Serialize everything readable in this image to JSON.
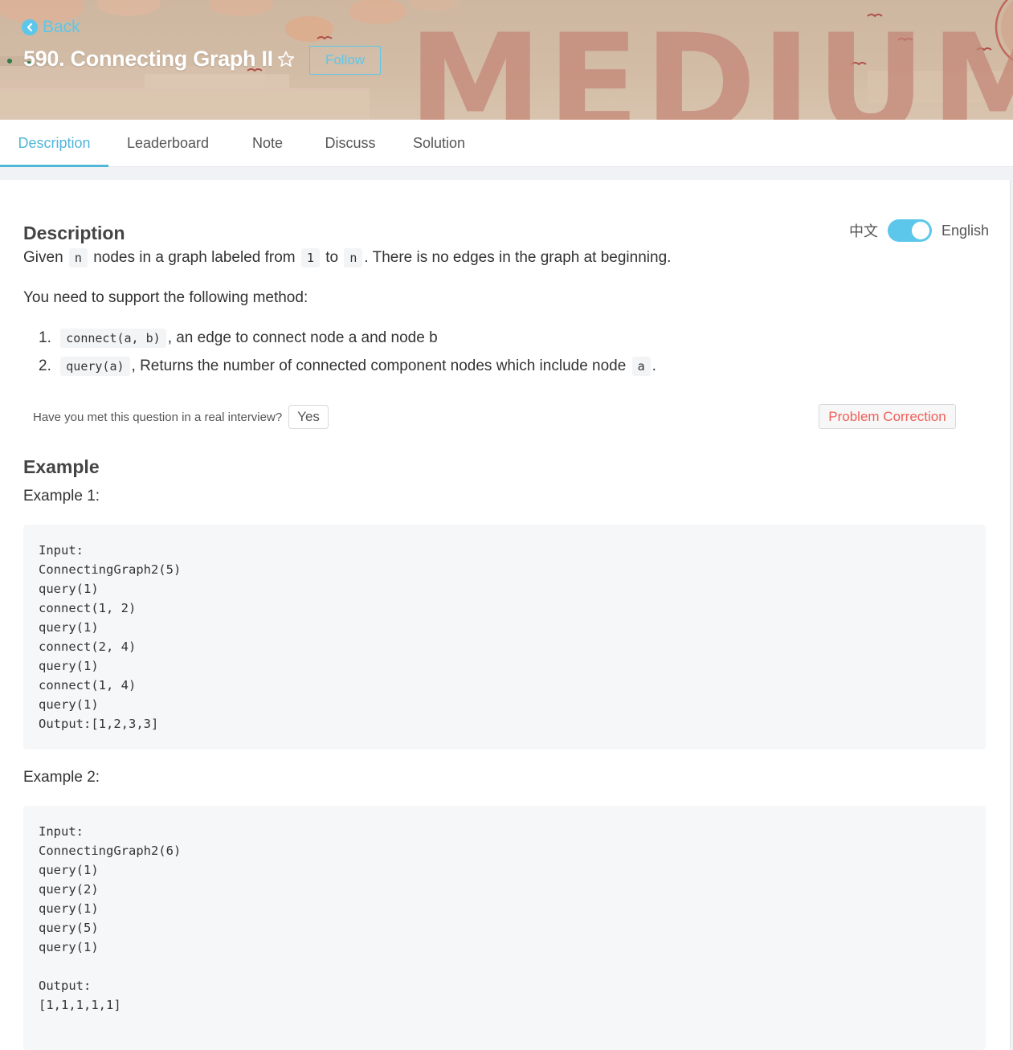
{
  "banner": {
    "back_label": "Back",
    "title": "590. Connecting Graph II",
    "follow_label": "Follow",
    "difficulty_watermark": "MEDIUM"
  },
  "tabs": [
    {
      "label": "Description",
      "active": true
    },
    {
      "label": "Leaderboard",
      "active": false
    },
    {
      "label": "Note",
      "active": false
    },
    {
      "label": "Discuss",
      "active": false
    },
    {
      "label": "Solution",
      "active": false
    }
  ],
  "language": {
    "chinese_label": "中文",
    "english_label": "English",
    "toggle_on": true
  },
  "description": {
    "heading": "Description",
    "intro_pre": "Given",
    "intro_code_n": "n",
    "intro_mid1": "nodes in a graph labeled from",
    "intro_code_1": "1",
    "intro_mid2": "to",
    "intro_code_n2": "n",
    "intro_post": ". There is no edges in the graph at beginning.",
    "support_text": "You need to support the following method:",
    "methods": [
      {
        "num": "1.",
        "code": "connect(a, b)",
        "text": ", an edge to connect node a and node b"
      },
      {
        "num": "2.",
        "code": "query(a)",
        "text": ", Returns the number of connected component nodes which include node",
        "code2": "a",
        "text2": "."
      }
    ]
  },
  "interview": {
    "question": "Have you met this question in a real interview?",
    "yes_label": "Yes",
    "correction_label": "Problem Correction"
  },
  "example": {
    "heading": "Example",
    "ex1_label": "Example 1:",
    "ex1_lines": [
      "Input:",
      "ConnectingGraph2(5)",
      "query(1)",
      "connect(1, 2)",
      "query(1)",
      "connect(2, 4)",
      "query(1)",
      "connect(1, 4)",
      "query(1)",
      "Output:[1,2,3,3]"
    ],
    "ex2_label": "Example 2:",
    "ex2_lines": [
      "Input:",
      "ConnectingGraph2(6)",
      "query(1)",
      "query(2)",
      "query(1)",
      "query(5)",
      "query(1)",
      "",
      "Output:",
      "[1,1,1,1,1]"
    ]
  },
  "colors": {
    "accent": "#5cc7ea",
    "tab_active": "#4fb6d8",
    "correction_text": "#f0605a",
    "banner_bg": "#d2bca6"
  },
  "icons": {
    "back": "chevron-left-circle-icon",
    "star": "star-outline-icon"
  }
}
